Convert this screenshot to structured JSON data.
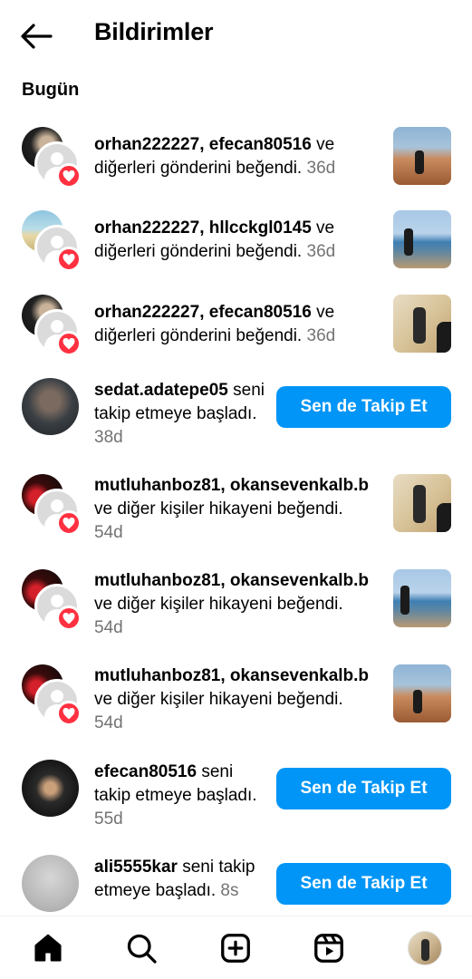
{
  "header": {
    "title": "Bildirimler",
    "back_icon": "arrow-left-icon"
  },
  "section": {
    "label": "Bugün"
  },
  "notifications": [
    {
      "user1": "orhan222227",
      "sep": ", ",
      "user2": "efecan80516",
      "text": " ve diğerleri gönderini beğendi.",
      "time": "36d"
    },
    {
      "user1": "orhan222227",
      "sep": ", ",
      "user2": "hllcckgl0145",
      "text": " ve diğerleri gönderini beğendi.",
      "time": "36d"
    },
    {
      "user1": "orhan222227",
      "sep": ", ",
      "user2": "efecan80516",
      "text": " ve diğerleri gönderini beğendi.",
      "time": "36d"
    },
    {
      "user1": "sedat.adatepe05",
      "text": " seni takip etmeye başladı.",
      "time": "38d",
      "button": "Sen de Takip Et"
    },
    {
      "user1": "mutluhanboz81",
      "sep": ", ",
      "user2": "okansevenkalb.b",
      "text": " ve diğer kişiler hikayeni beğendi.",
      "time": "54d"
    },
    {
      "user1": "mutluhanboz81",
      "sep": ", ",
      "user2": "okansevenkalb.b",
      "text": " ve diğer kişiler hikayeni beğendi.",
      "time": "54d"
    },
    {
      "user1": "mutluhanboz81",
      "sep": ", ",
      "user2": "okansevenkalb.b",
      "text": " ve diğer kişiler hikayeni beğendi.",
      "time": "54d"
    },
    {
      "user1": "efecan80516",
      "text": " seni takip etmeye başladı.",
      "time": "55d",
      "button": "Sen de Takip Et"
    },
    {
      "user1": "ali5555kar",
      "text": " seni takip etmeye başladı.",
      "time": "8s",
      "button": "Sen de Takip Et"
    }
  ],
  "nav": {
    "items": [
      "home-icon",
      "search-icon",
      "create-post-icon",
      "reels-icon",
      "profile-avatar"
    ]
  },
  "colors": {
    "accent": "#0095f6",
    "like": "#ff3040",
    "muted": "#737373"
  }
}
